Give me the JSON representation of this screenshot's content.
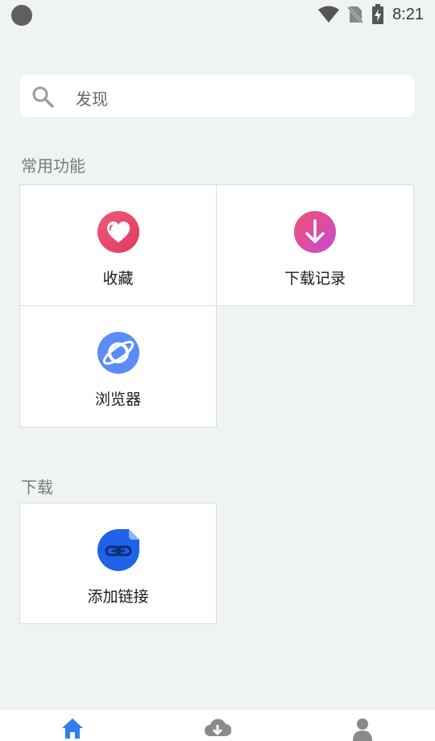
{
  "status_bar": {
    "time": "8:21"
  },
  "search": {
    "placeholder": "发现"
  },
  "sections": {
    "common": {
      "title": "常用功能",
      "items": [
        {
          "label": "收藏",
          "icon": "heart-icon",
          "color": "#e6436c"
        },
        {
          "label": "下载记录",
          "icon": "download-arrow-icon",
          "color": "#e94f86"
        },
        {
          "label": "浏览器",
          "icon": "browser-planet-icon",
          "color": "#5b8cf6"
        }
      ]
    },
    "download": {
      "title": "下载",
      "items": [
        {
          "label": "添加链接",
          "icon": "link-icon",
          "color": "#1e63e8"
        }
      ]
    }
  },
  "bottom_nav": {
    "items": [
      {
        "icon": "home-icon",
        "color": "#2f7ff0",
        "active": true
      },
      {
        "icon": "cloud-download-icon",
        "color": "#8a8a8a",
        "active": false
      },
      {
        "icon": "user-icon",
        "color": "#8a8a8a",
        "active": false
      }
    ]
  }
}
